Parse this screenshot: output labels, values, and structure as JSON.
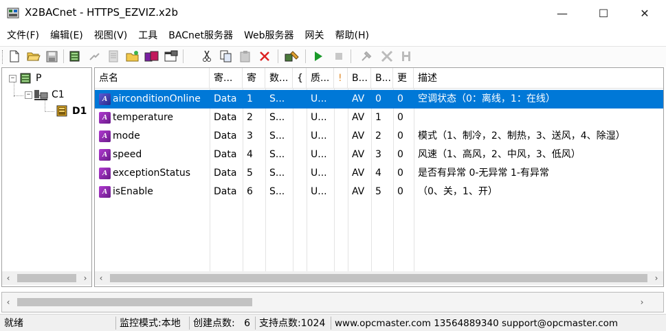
{
  "window": {
    "title": "X2BACnet - HTTPS_EZVIZ.x2b",
    "minimize_glyph": "—",
    "maximize_glyph": "☐",
    "close_glyph": "✕"
  },
  "menu": [
    {
      "label": "文件(F)"
    },
    {
      "label": "编辑(E)"
    },
    {
      "label": "视图(V)"
    },
    {
      "label": "工具"
    },
    {
      "label": "BACnet服务器"
    },
    {
      "label": "Web服务器"
    },
    {
      "label": "网关"
    },
    {
      "label": "帮助(H)"
    }
  ],
  "toolbar": {
    "icons": [
      "new-file-icon",
      "open-folder-icon",
      "save-icon",
      "device-icon",
      "import-icon",
      "edit-icon",
      "add-point-icon",
      "multi-device-icon",
      "properties-icon",
      "cut-icon",
      "copy-icon",
      "paste-icon",
      "delete-icon",
      "tool-icon",
      "run-icon",
      "stop-icon",
      "config-icon",
      "network-icon",
      "settings-icon"
    ]
  },
  "tree": {
    "root": {
      "label": "P",
      "expander": "−"
    },
    "channel": {
      "label": "C1",
      "expander": "−"
    },
    "device": {
      "label": "D1"
    }
  },
  "table": {
    "columns": [
      "点名",
      "寄...",
      "寄",
      "数...",
      "{",
      "质...",
      "!",
      "B...",
      "B...",
      "更",
      "描述"
    ],
    "rows": [
      {
        "name": "airconditionOnline",
        "c1": "Data",
        "c2": "1",
        "c3": "S...",
        "c4": "",
        "c5": "U...",
        "c6": "",
        "c7": "AV",
        "c8": "0",
        "c9": "0",
        "desc": "空调状态（0：离线，1：在线）"
      },
      {
        "name": "temperature",
        "c1": "Data",
        "c2": "2",
        "c3": "S...",
        "c4": "",
        "c5": "U...",
        "c6": "",
        "c7": "AV",
        "c8": "1",
        "c9": "0",
        "desc": ""
      },
      {
        "name": "mode",
        "c1": "Data",
        "c2": "3",
        "c3": "S...",
        "c4": "",
        "c5": "U...",
        "c6": "",
        "c7": "AV",
        "c8": "2",
        "c9": "0",
        "desc": "模式（1、制冷，2、制热，3、送风，4、除湿）"
      },
      {
        "name": "speed",
        "c1": "Data",
        "c2": "4",
        "c3": "S...",
        "c4": "",
        "c5": "U...",
        "c6": "",
        "c7": "AV",
        "c8": "3",
        "c9": "0",
        "desc": "风速（1、高风，2、中风，3、低风）"
      },
      {
        "name": "exceptionStatus",
        "c1": "Data",
        "c2": "5",
        "c3": "S...",
        "c4": "",
        "c5": "U...",
        "c6": "",
        "c7": "AV",
        "c8": "4",
        "c9": "0",
        "desc": "是否有异常 0-无异常 1-有异常"
      },
      {
        "name": "isEnable",
        "c1": "Data",
        "c2": "6",
        "c3": "S...",
        "c4": "",
        "c5": "U...",
        "c6": "",
        "c7": "AV",
        "c8": "5",
        "c9": "0",
        "desc": "（0、关，1、开）"
      }
    ],
    "selected_row": 0,
    "row_icon_label": "A"
  },
  "scroll": {
    "left": "‹",
    "right": "›"
  },
  "statusbar": {
    "ready": "就绪",
    "mode": "监控模式:本地",
    "created": "创建点数:   6",
    "supported": "支持点数:1024",
    "contact": "www.opcmaster.com 13564889340 support@opcmaster.com"
  },
  "colors": {
    "selection": "#0078d7",
    "av_icon": "#8e2bb0"
  }
}
